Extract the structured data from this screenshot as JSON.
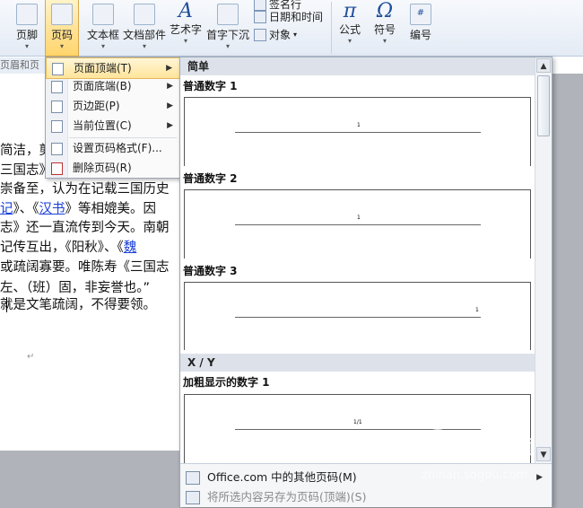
{
  "ribbon": {
    "buttons": [
      {
        "id": "footer",
        "label": "页脚"
      },
      {
        "id": "page_number",
        "label": "页码"
      },
      {
        "id": "text_box",
        "label": "文本框"
      },
      {
        "id": "quick_parts",
        "label": "文档部件"
      },
      {
        "id": "wordart",
        "label": "艺术字"
      },
      {
        "id": "drop_cap",
        "label": "首字下沉"
      },
      {
        "id": "equation",
        "label": "公式"
      },
      {
        "id": "symbol",
        "label": "符号"
      },
      {
        "id": "numbering",
        "label": "编号"
      }
    ],
    "small_buttons": {
      "signature_line": "签名行",
      "date_time": "日期和时间",
      "object": "对象"
    },
    "group_label": "页眉和页"
  },
  "document": {
    "lines": [
      {
        "parts": [
          {
            "t": "简洁，剪"
          }
        ]
      },
      {
        "parts": [
          {
            "t": "三国志》"
          }
        ]
      },
      {
        "parts": [
          {
            "t": "崇备至，认为在记载三国历史"
          }
        ]
      },
      {
        "parts": [
          {
            "t": "记",
            "link": true
          },
          {
            "t": "》、《"
          },
          {
            "t": "汉书",
            "link": true
          },
          {
            "t": "》等相媲美。因"
          }
        ]
      },
      {
        "parts": [
          {
            "t": "志》还一直流传到今天。南朝"
          }
        ]
      },
      {
        "parts": [
          {
            "t": " 记传互出，《阳秋》、《"
          },
          {
            "t": "魏",
            "link": true
          }
        ]
      },
      {
        "parts": [
          {
            "t": "或疏阔寡要。唯陈寿《三国志"
          }
        ]
      },
      {
        "parts": [
          {
            "t": "左、（班）固，非妄誉也。”"
          }
        ]
      },
      {
        "parts": [
          {
            "t": " 就是文笔疏阔，不得要领。"
          }
        ]
      }
    ]
  },
  "menu": {
    "items": [
      {
        "label": "页面顶端(T)",
        "arrow": "▶",
        "icon": "page-top-icon"
      },
      {
        "label": "页面底端(B)",
        "arrow": "▶",
        "icon": "page-bottom-icon"
      },
      {
        "label": "页边距(P)",
        "arrow": "▶",
        "icon": "page-margin-icon"
      },
      {
        "label": "当前位置(C)",
        "arrow": "▶",
        "icon": "current-position-icon"
      },
      {
        "label": "设置页码格式(F)...",
        "icon": "format-page-number-icon"
      },
      {
        "label": "删除页码(R)",
        "icon": "remove-page-number-icon"
      }
    ]
  },
  "gallery": {
    "section_simple": "简单",
    "items": [
      {
        "title": "普通数字 1",
        "number": "1"
      },
      {
        "title": "普通数字 2",
        "number": "1"
      },
      {
        "title": "普通数字 3",
        "number": "1"
      }
    ],
    "section_xy": "X / Y",
    "bold_item": {
      "title": "加粗显示的数字 1",
      "number": "1/1"
    },
    "footer": {
      "more": "Office.com 中的其他页码(M)",
      "save": "将所选内容另存为页码(顶端)(S)",
      "arrow": "▶"
    },
    "scroll_up": "▲",
    "scroll_down": "▼"
  },
  "watermark": {
    "text": "搜狗指南",
    "sub": "zhinan.sogou.com"
  }
}
